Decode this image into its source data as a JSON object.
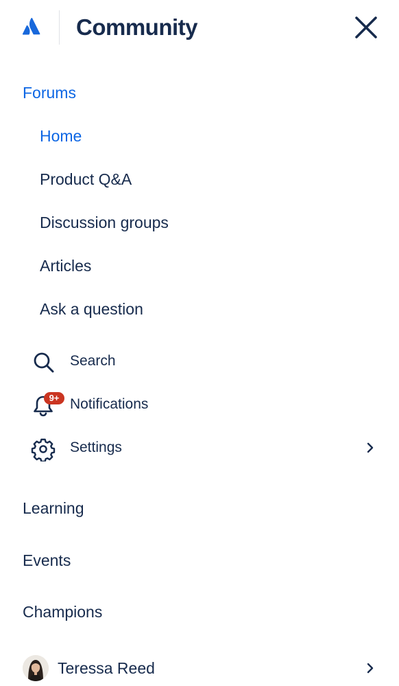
{
  "header": {
    "title": "Community",
    "logo_icon": "atlassian-logo-icon",
    "close_icon": "close-icon"
  },
  "nav": {
    "forums": "Forums",
    "forum_items": [
      "Home",
      "Product Q&A",
      "Discussion groups",
      "Articles",
      "Ask a question"
    ],
    "utilities": {
      "search": "Search",
      "notifications": "Notifications",
      "notifications_badge": "9+",
      "settings": "Settings"
    },
    "learning": "Learning",
    "events": "Events",
    "champions": "Champions"
  },
  "user": {
    "name": "Teressa Reed"
  },
  "colors": {
    "accent": "#0C66E4",
    "text": "#172B4D",
    "badge": "#CA3521"
  }
}
